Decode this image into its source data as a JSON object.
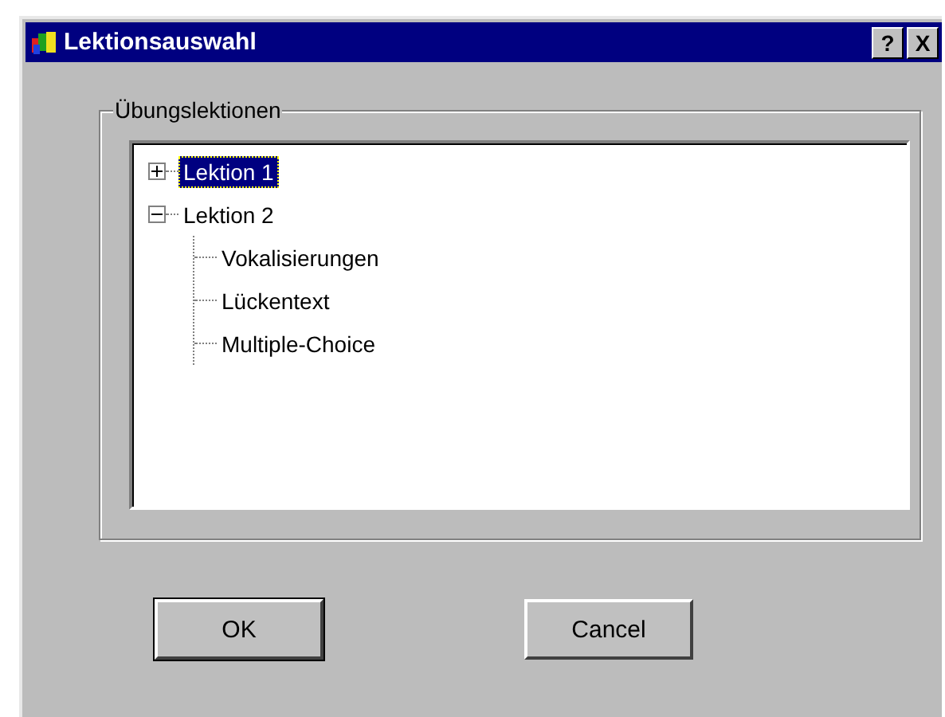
{
  "window": {
    "title": "Lektionsauswahl",
    "title_buttons": [
      "?",
      "X"
    ]
  },
  "group": {
    "label": "Übungslektionen",
    "tree": [
      {
        "label": "Lektion 1",
        "expanded": false,
        "selected": true
      },
      {
        "label": "Lektion 2",
        "expanded": true,
        "selected": false,
        "children": [
          {
            "label": "Vokalisierungen",
            "selected": false
          },
          {
            "label": "Lückentext",
            "selected": false
          },
          {
            "label": "Multiple-Choice",
            "selected": false
          }
        ]
      }
    ]
  },
  "buttons": [
    {
      "label": "OK",
      "default": true
    },
    {
      "label": "Cancel",
      "default": false
    }
  ]
}
